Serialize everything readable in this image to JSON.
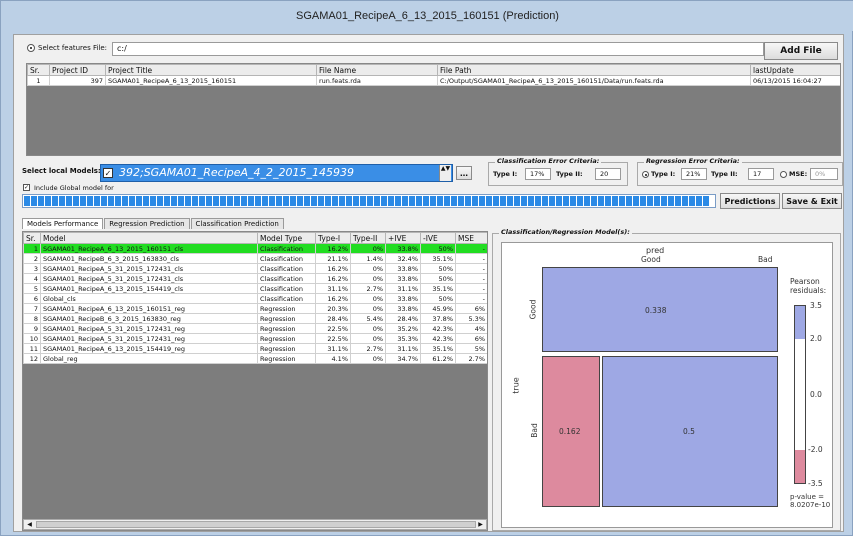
{
  "window": {
    "title": "SGAMA01_RecipeA_6_13_2015_160151 (Prediction)"
  },
  "features": {
    "radio_label": "Select features File:",
    "path_value": "c:/",
    "add_file_label": "Add File",
    "columns": [
      "Sr.",
      "Project ID",
      "Project Title",
      "File Name",
      "File Path",
      "lastUpdate"
    ],
    "rows": [
      [
        "1",
        "397",
        "SGAMA01_RecipeA_6_13_2015_160151",
        "run.feats.rda",
        "C:/Output/SGAMA01_RecipeA_6_13_2015_160151/Data/run.feats.rda",
        "06/13/2015 16:04:27"
      ]
    ]
  },
  "models": {
    "select_label": "Select local Models:",
    "selected_model": "392;SGAMA01_RecipeA_4_2_2015_145939",
    "include_global_label": "Include Global model for"
  },
  "classification_criteria": {
    "title": "Classification Error Criteria:",
    "type1_label": "Type I:",
    "type1_value": "17%",
    "type2_label": "Type II:",
    "type2_value": "20"
  },
  "regression_criteria": {
    "title": "Regression Error Criteria:",
    "type1_label": "Type I:",
    "type1_value": "21%",
    "type2_label": "Type II:",
    "type2_value": "17",
    "mse_label": "MSE:",
    "mse_value": "0%"
  },
  "buttons": {
    "predictions": "Predictions",
    "save_exit": "Save & Exit"
  },
  "progress": {
    "fraction": 1.0,
    "color": "#2b8ae6"
  },
  "tabs": [
    "Models Performance",
    "Regression Prediction",
    "Classification Prediction"
  ],
  "performance": {
    "columns": [
      "Sr.",
      "Model",
      "Model Type",
      "Type-I",
      "Type-II",
      "+IVE",
      "-IVE",
      "MSE"
    ],
    "highlight_color": "#22dd22",
    "rows": [
      [
        "1",
        "SGAMA01_RecipeA_6_13_2015_160151_cls",
        "Classification",
        "16.2%",
        "0%",
        "33.8%",
        "50%",
        "-"
      ],
      [
        "2",
        "SGAMA01_RecipeB_6_3_2015_163830_cls",
        "Classification",
        "21.1%",
        "1.4%",
        "32.4%",
        "35.1%",
        "-"
      ],
      [
        "3",
        "SGAMA01_RecipeA_5_31_2015_172431_cls",
        "Classification",
        "16.2%",
        "0%",
        "33.8%",
        "50%",
        "-"
      ],
      [
        "4",
        "SGAMA01_RecipeA_5_31_2015_172431_cls",
        "Classification",
        "16.2%",
        "0%",
        "33.8%",
        "50%",
        "-"
      ],
      [
        "5",
        "SGAMA01_RecipeA_6_13_2015_154419_cls",
        "Classification",
        "31.1%",
        "2.7%",
        "31.1%",
        "35.1%",
        "-"
      ],
      [
        "6",
        "Global_cls",
        "Classification",
        "16.2%",
        "0%",
        "33.8%",
        "50%",
        "-"
      ],
      [
        "7",
        "SGAMA01_RecipeA_6_13_2015_160151_reg",
        "Regression",
        "20.3%",
        "0%",
        "33.8%",
        "45.9%",
        "6%"
      ],
      [
        "8",
        "SGAMA01_RecipeB_6_3_2015_163830_reg",
        "Regression",
        "28.4%",
        "5.4%",
        "28.4%",
        "37.8%",
        "5.3%"
      ],
      [
        "9",
        "SGAMA01_RecipeA_5_31_2015_172431_reg",
        "Regression",
        "22.5%",
        "0%",
        "35.2%",
        "42.3%",
        "4%"
      ],
      [
        "10",
        "SGAMA01_RecipeA_5_31_2015_172431_reg",
        "Regression",
        "22.5%",
        "0%",
        "35.3%",
        "42.3%",
        "6%"
      ],
      [
        "11",
        "SGAMA01_RecipeA_6_13_2015_154419_reg",
        "Regression",
        "31.1%",
        "2.7%",
        "31.1%",
        "35.1%",
        "5%"
      ],
      [
        "12",
        "Global_reg",
        "Regression",
        "4.1%",
        "0%",
        "34.7%",
        "61.2%",
        "2.7%"
      ]
    ]
  },
  "plot_panel": {
    "title": "Classification/Regression Model(s):",
    "pred_label": "pred",
    "true_label": "true",
    "col_labels": [
      "Good",
      "Bad"
    ],
    "row_labels": [
      "Good",
      "Bad"
    ],
    "cells": {
      "good_good": "0.338",
      "bad_good": "0.162",
      "bad_bad": "0.5"
    },
    "legend_title": "Pearson residuals:",
    "legend_ticks": [
      "3.5",
      "2.0",
      "0.0",
      "-2.0",
      "-3.5"
    ],
    "pvalue": "p-value = 8.0207e-10",
    "colors": {
      "blue": "#9ea8e4",
      "pink": "#dd8a9e"
    }
  }
}
